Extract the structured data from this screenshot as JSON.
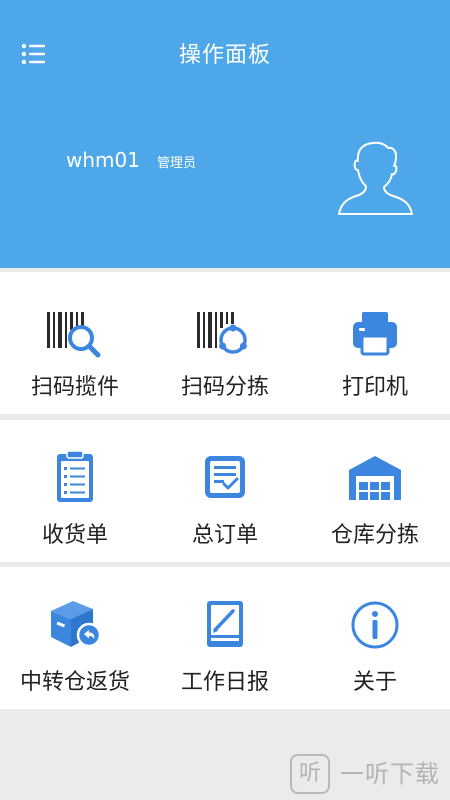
{
  "header": {
    "title": "操作面板",
    "username": "whm01",
    "role": "管理员",
    "background": "#4ea7e8"
  },
  "menu": {
    "sections": [
      {
        "items": [
          {
            "label": "扫码揽件",
            "icon": "barcode-search-icon"
          },
          {
            "label": "扫码分拣",
            "icon": "barcode-sort-icon"
          },
          {
            "label": "打印机",
            "icon": "printer-icon"
          }
        ]
      },
      {
        "items": [
          {
            "label": "收货单",
            "icon": "clipboard-list-icon"
          },
          {
            "label": "总订单",
            "icon": "order-document-icon"
          },
          {
            "label": "仓库分拣",
            "icon": "warehouse-icon"
          }
        ]
      },
      {
        "items": [
          {
            "label": "中转仓返货",
            "icon": "box-return-icon"
          },
          {
            "label": "工作日报",
            "icon": "daily-report-icon"
          },
          {
            "label": "关于",
            "icon": "info-icon"
          }
        ]
      }
    ]
  },
  "watermark": {
    "glyph": "听",
    "text": "一听下载"
  },
  "colors": {
    "accent": "#4ea7e8",
    "icon_blue": "#3d86e0",
    "icon_dark": "#2b2b2b"
  }
}
